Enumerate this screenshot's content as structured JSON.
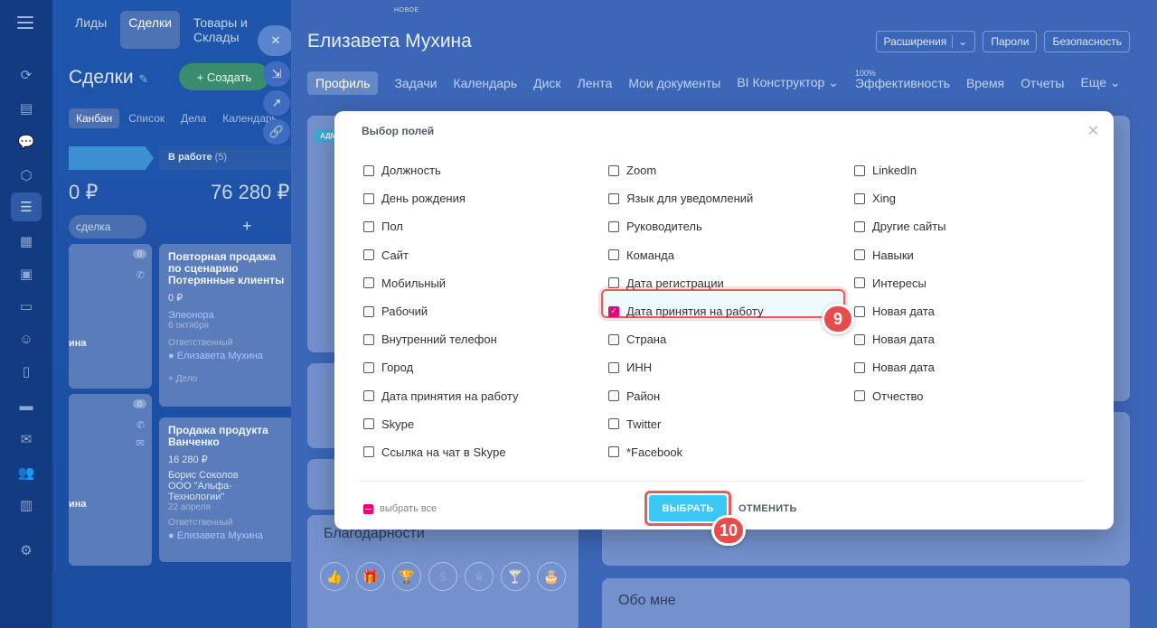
{
  "crm": {
    "nav": [
      "Лиды",
      "Сделки",
      "Товары и Склады"
    ],
    "title": "Сделки",
    "create_label": "Создать",
    "views": [
      "Канбан",
      "Список",
      "Дела",
      "Календарь"
    ],
    "col_a_sum": "0 ₽",
    "col_b_title": "В работе",
    "col_b_count": "(5)",
    "col_b_sum": "76 280 ₽",
    "quick_deal": "сделка",
    "cards": [
      {
        "title": "Повторная продажа по сценарию Потерянные клиенты",
        "amount": "0 ₽",
        "contact": "Элеонора",
        "date": "6 октября",
        "resp_label": "Ответственный",
        "resp": "Елизавета Мухина",
        "add": "+ Дело"
      },
      {
        "title": "Продажа продукта Ванченко",
        "amount": "16 280 ₽",
        "contact": "Борис Соколов",
        "company": "ООО \"Альфа-Технологии\"",
        "date": "22 апреля",
        "resp_label": "Ответственный",
        "resp": "Елизавета Мухина"
      }
    ],
    "side_count_1": "0",
    "side_count_2": "0",
    "side_word": "ина"
  },
  "profile": {
    "new_tag": "НОВОЕ",
    "name": "Елизавета Мухина",
    "buttons": [
      "Расширения",
      "Пароли",
      "Безопасность"
    ],
    "tabs": [
      "Профиль",
      "Задачи",
      "Календарь",
      "Диск",
      "Лента",
      "Мои документы",
      "BI Конструктор",
      "Эффективность",
      "Время",
      "Отчеты",
      "Еще"
    ],
    "efficiency_top": "100%",
    "thanks_title": "Благодарности",
    "about_title": "Обо мне",
    "badge_text": "АДМ"
  },
  "modal": {
    "title": "Выбор полей",
    "columns": [
      [
        {
          "label": "Должность",
          "checked": false
        },
        {
          "label": "День рождения",
          "checked": false
        },
        {
          "label": "Пол",
          "checked": false
        },
        {
          "label": "Сайт",
          "checked": false
        },
        {
          "label": "Мобильный",
          "checked": false
        },
        {
          "label": "Рабочий",
          "checked": false
        },
        {
          "label": "Внутренний телефон",
          "checked": false
        },
        {
          "label": "Город",
          "checked": false
        },
        {
          "label": "Дата принятия на работу",
          "checked": false
        },
        {
          "label": "Skype",
          "checked": false
        },
        {
          "label": "Ссылка на чат в Skype",
          "checked": false
        }
      ],
      [
        {
          "label": "Zoom",
          "checked": false
        },
        {
          "label": "Язык для уведомлений",
          "checked": false
        },
        {
          "label": "Руководитель",
          "checked": false
        },
        {
          "label": "Команда",
          "checked": false
        },
        {
          "label": "Дата регистрации",
          "checked": false
        },
        {
          "label": "Дата принятия на работу",
          "checked": true
        },
        {
          "label": "Страна",
          "checked": false
        },
        {
          "label": "ИНН",
          "checked": false
        },
        {
          "label": "Район",
          "checked": false
        },
        {
          "label": "Twitter",
          "checked": false
        },
        {
          "label": "*Facebook",
          "checked": false
        }
      ],
      [
        {
          "label": "LinkedIn",
          "checked": false
        },
        {
          "label": "Xing",
          "checked": false
        },
        {
          "label": "Другие сайты",
          "checked": false
        },
        {
          "label": "Навыки",
          "checked": false
        },
        {
          "label": "Интересы",
          "checked": false
        },
        {
          "label": "Новая дата",
          "checked": false
        },
        {
          "label": "Новая дата",
          "checked": false
        },
        {
          "label": "Новая дата",
          "checked": false
        },
        {
          "label": "Отчество",
          "checked": false
        }
      ]
    ],
    "select_all": "выбрать все",
    "select_button": "ВЫБРАТЬ",
    "cancel_button": "ОТМЕНИТЬ"
  },
  "markers": [
    "9",
    "10"
  ],
  "colors": {
    "accent": "#3bc8f5",
    "checkbox": "#e6007a",
    "marker": "#e84b4b"
  }
}
